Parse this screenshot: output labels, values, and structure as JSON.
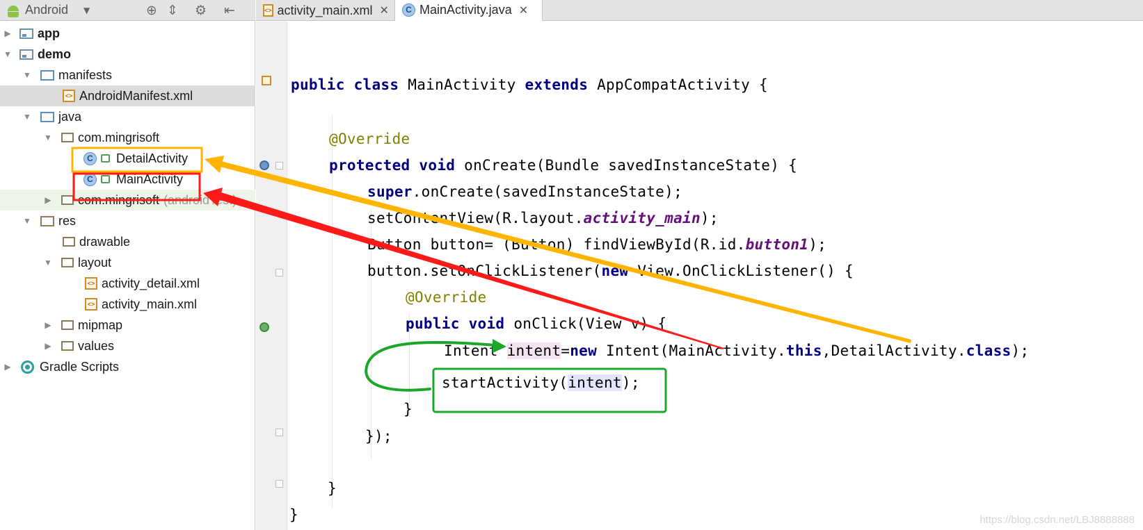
{
  "project_view": {
    "selector_label": "Android",
    "tree": [
      {
        "label": "app",
        "bold": true
      },
      {
        "label": "demo",
        "bold": true
      },
      {
        "label": "manifests"
      },
      {
        "label": "AndroidManifest.xml"
      },
      {
        "label": "java"
      },
      {
        "label": "com.mingrisoft"
      },
      {
        "label": "DetailActivity"
      },
      {
        "label": "MainActivity"
      },
      {
        "label": "com.mingrisoft",
        "suffix": "(androidTest)"
      },
      {
        "label": "res"
      },
      {
        "label": "drawable"
      },
      {
        "label": "layout"
      },
      {
        "label": "activity_detail.xml"
      },
      {
        "label": "activity_main.xml"
      },
      {
        "label": "mipmap"
      },
      {
        "label": "values"
      },
      {
        "label": "Gradle Scripts"
      }
    ]
  },
  "tabs": [
    {
      "label": "activity_main.xml",
      "active": false
    },
    {
      "label": "MainActivity.java",
      "active": true
    }
  ],
  "code": {
    "l1": {
      "kw1": "public class",
      "t1": " MainActivity ",
      "kw2": "extends",
      "t2": " AppCompatActivity {"
    },
    "l2": {
      "ann": "@Override"
    },
    "l3": {
      "kw": "protected void",
      "t": " onCreate(Bundle savedInstanceState) {"
    },
    "l4": {
      "kw": "super",
      "t": ".onCreate(savedInstanceState);"
    },
    "l5": {
      "t1": "setContentView(R.layout.",
      "fld": "activity_main",
      "t2": ");"
    },
    "l6": {
      "t1": "Button button= (Button) findViewById(R.id.",
      "fld": "button1",
      "t2": ");"
    },
    "l7": {
      "t1": "button.setOnClickListener(",
      "kw": "new",
      "t2": " View.OnClickListener() {"
    },
    "l8": {
      "ann": "@Override"
    },
    "l9": {
      "kw": "public void",
      "t": " onClick(View v) {"
    },
    "l10": {
      "t1": "Intent ",
      "var": "intent",
      "t2": "=",
      "kw": "new",
      "t3": " Intent(MainActivity.",
      "kw2": "this",
      "t4": ",DetailActivity.",
      "kw3": "class",
      "t5": ");"
    },
    "l11": {
      "t1": "startActivity(",
      "var": "intent",
      "t2": ");"
    },
    "l12": "}",
    "l13": "});",
    "l14": "}",
    "l15": "}"
  },
  "watermark": "https://blog.csdn.net/LBJ8888888",
  "colors": {
    "keyword": "#000080",
    "annotation": "#808000",
    "field": "#660e7a",
    "arrow_red": "#ff1a1a",
    "arrow_yellow": "#ffb400",
    "annotation_green": "#1aa82a"
  }
}
